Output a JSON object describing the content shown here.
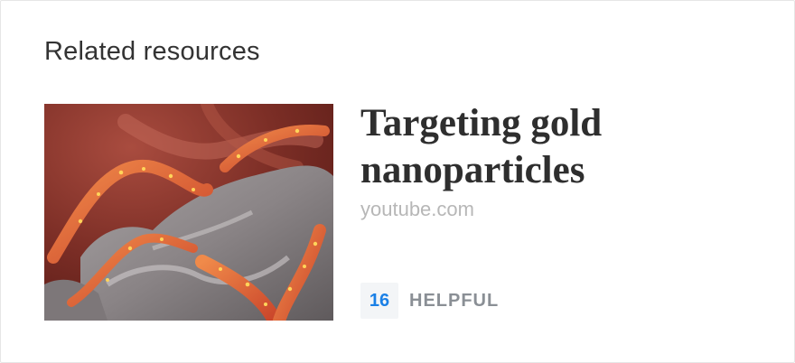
{
  "section": {
    "title": "Related resources"
  },
  "resource": {
    "title": "Targeting gold nanoparticles",
    "source": "youtube.com",
    "helpful_count": "16",
    "helpful_label": "HELPFUL",
    "thumbnail_alt": "Targeting gold nanoparticles"
  }
}
